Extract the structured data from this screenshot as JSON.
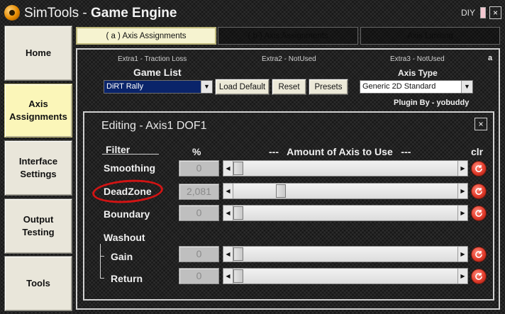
{
  "window": {
    "title_prefix": "SimTools - ",
    "title_bold": "Game Engine",
    "diy_label": "DIY",
    "close_glyph": "×"
  },
  "nav": {
    "items": [
      {
        "label": "Home"
      },
      {
        "label": "Axis Assignments"
      },
      {
        "label": "Interface Settings"
      },
      {
        "label": "Output Testing"
      },
      {
        "label": "Tools"
      }
    ]
  },
  "tabs": [
    {
      "label": "( a ) Axis Assignments"
    },
    {
      "label": "( b ) Axis Assignments"
    },
    {
      "label": "Axis Limiting"
    }
  ],
  "game_panel": {
    "extra1": "Extra1 - Traction Loss",
    "extra2": "Extra2 - NotUsed",
    "extra3": "Extra3 - NotUsed",
    "corner_label": "a",
    "game_list_label": "Game List",
    "game_selected": "DiRT Rally",
    "load_default_label": "Load Default",
    "reset_label": "Reset",
    "presets_label": "Presets",
    "axis_type_label": "Axis Type",
    "axis_type_selected": "Generic 2D Standard",
    "plugin_by": "Plugin By - yobuddy"
  },
  "editing": {
    "title": "Editing - Axis1 DOF1",
    "close_glyph": "×",
    "filter_header": "Filter",
    "percent_header": "%",
    "amount_header": "---   Amount of Axis to Use   ---",
    "clr_header": "clr",
    "washout_label": "Washout",
    "rows": [
      {
        "label": "Smoothing",
        "value": "0",
        "slider_fraction": 0
      },
      {
        "label": "DeadZone",
        "value": "2,081",
        "slider_fraction": 0.2
      },
      {
        "label": "Boundary",
        "value": "0",
        "slider_fraction": 0
      },
      {
        "label": "Gain",
        "value": "0",
        "slider_fraction": 0
      },
      {
        "label": "Return",
        "value": "0",
        "slider_fraction": 0
      }
    ]
  },
  "colors": {
    "accent_active": "#fbf6b9",
    "highlight_circle": "#d11414",
    "clear_button": "#e23b2b"
  }
}
